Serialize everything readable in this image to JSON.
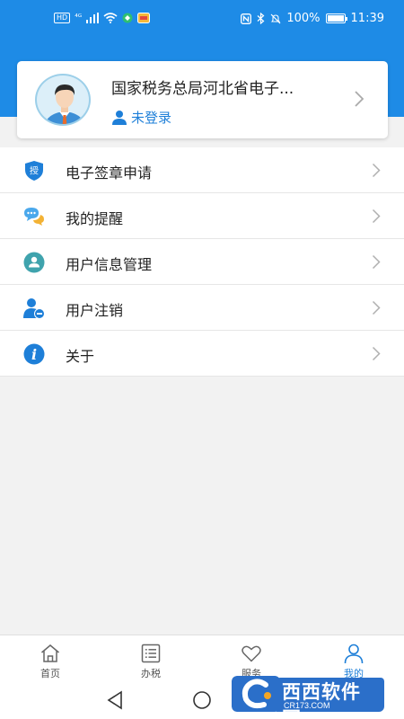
{
  "status_bar": {
    "left_badge": "HD",
    "network": "⁴ᴳ",
    "battery_percent": "100%",
    "battery_level": 1.0,
    "time": "11:39"
  },
  "profile": {
    "org_name": "国家税务总局河北省电子...",
    "login_status": "未登录"
  },
  "menu": {
    "items": [
      {
        "label": "电子签章申请",
        "icon": "authorize-shield-icon",
        "icon_char": "授"
      },
      {
        "label": "我的提醒",
        "icon": "reminder-chat-icon"
      },
      {
        "label": "用户信息管理",
        "icon": "user-info-icon"
      },
      {
        "label": "用户注销",
        "icon": "user-remove-icon"
      },
      {
        "label": "关于",
        "icon": "info-icon",
        "icon_char": "i"
      }
    ]
  },
  "tabs": [
    {
      "label": "首页",
      "icon": "home-icon"
    },
    {
      "label": "办税",
      "icon": "list-icon"
    },
    {
      "label": "服务",
      "icon": "heart-icon"
    },
    {
      "label": "我的",
      "icon": "person-icon",
      "active": true
    }
  ],
  "watermark": {
    "text": "西西软件园",
    "site": "CR173.COM"
  },
  "colors": {
    "primary": "#1e8be6",
    "accent_text": "#1e7fd8",
    "background": "#f2f2f2"
  }
}
